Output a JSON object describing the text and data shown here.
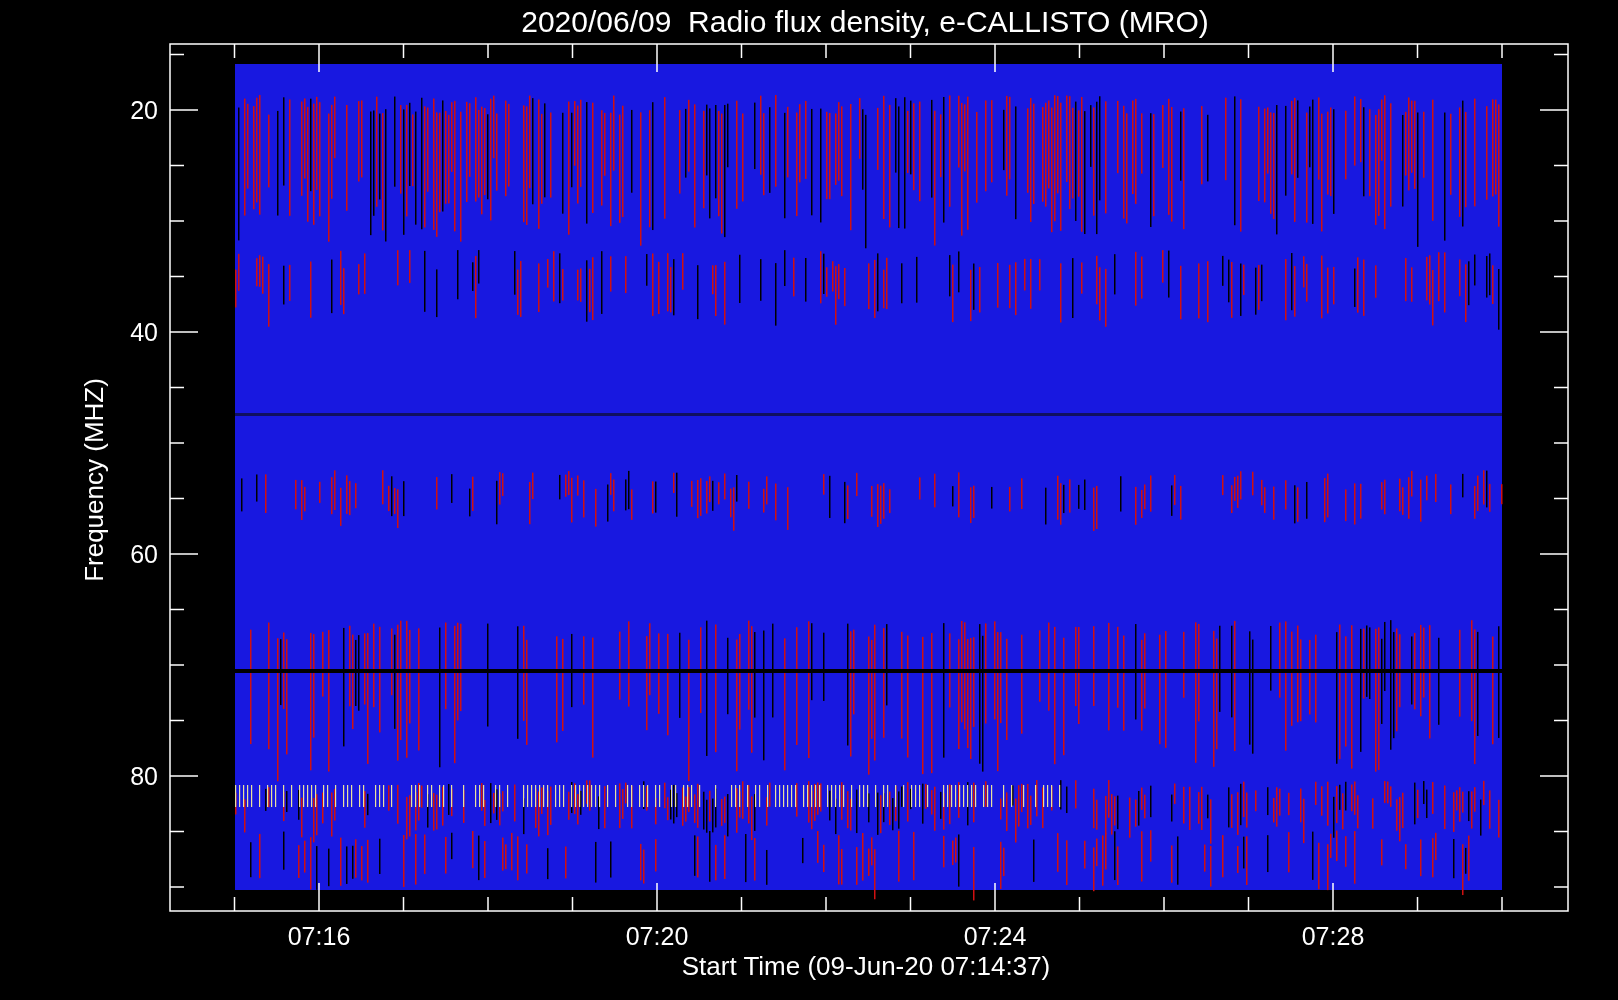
{
  "title": "2020/06/09  Radio flux density, e-CALLISTO (MRO)",
  "y_axis": {
    "label": "Frequency (MHZ)",
    "tick_labels": [
      "20",
      "40",
      "60",
      "80"
    ]
  },
  "x_axis": {
    "label": "Start Time (09-Jun-20 07:14:37)",
    "tick_labels": [
      "07:16",
      "07:20",
      "07:24",
      "07:28"
    ]
  }
}
